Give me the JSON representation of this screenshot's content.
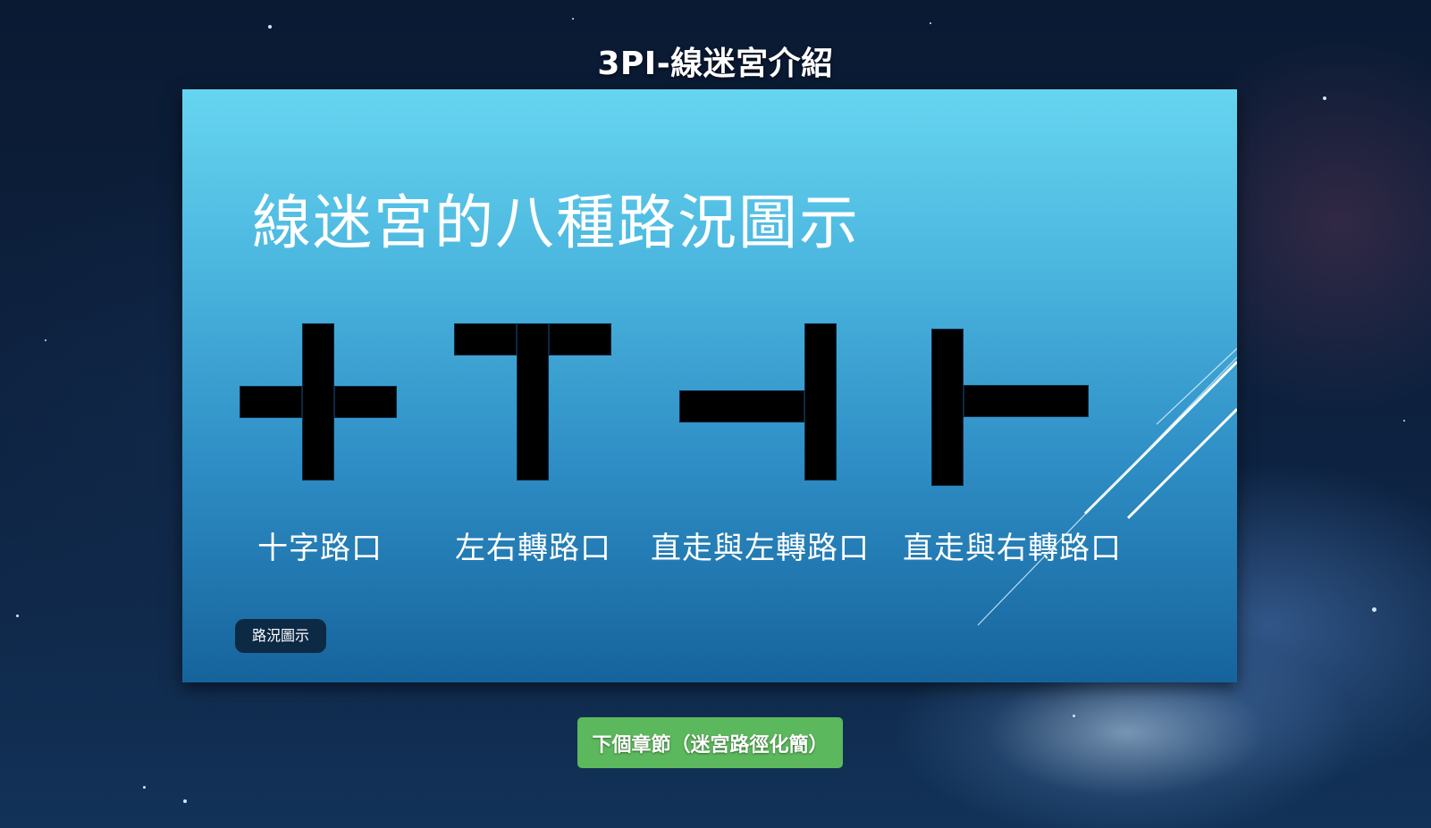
{
  "page": {
    "title": "3PI-線迷宮介紹"
  },
  "slide": {
    "heading": "線迷宮的八種路況圖示",
    "tag_label": "路況圖示",
    "junctions": [
      {
        "label": "十字路口",
        "icon": "cross-junction-icon"
      },
      {
        "label": "左右轉路口",
        "icon": "t-junction-icon"
      },
      {
        "label": "直走與左轉路口",
        "icon": "straight-left-junction-icon"
      },
      {
        "label": "直走與右轉路口",
        "icon": "straight-right-junction-icon"
      }
    ]
  },
  "navigation": {
    "next_button_label": "下個章節（迷宮路徑化簡）"
  },
  "colors": {
    "button_green": "#5cb85c",
    "slide_top": "#66d5f0",
    "slide_bottom": "#16639c",
    "tag_background": "#0d2a45"
  }
}
